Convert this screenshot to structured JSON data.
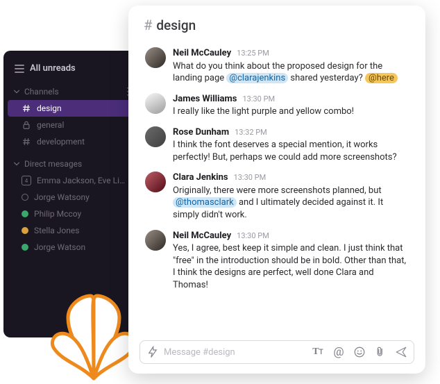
{
  "sidebar": {
    "all_unreads": "All unreads",
    "channels_label": "Channels",
    "channels": [
      {
        "label": "design",
        "iconName": "hash-icon",
        "active": true
      },
      {
        "label": "general",
        "iconName": "lock-icon",
        "active": false
      },
      {
        "label": "development",
        "iconName": "hash-icon",
        "active": false
      }
    ],
    "dms_label": "Direct mesages",
    "dms": [
      {
        "label": "Emma Jackson, Eve Li…",
        "indicator": "group",
        "indicatorText": "4"
      },
      {
        "label": "Jorge Watsony",
        "indicator": "offline"
      },
      {
        "label": "Philip Mccoy",
        "indicator": "online"
      },
      {
        "label": "Stella Jones",
        "indicator": "away"
      },
      {
        "label": "Jorge Watson",
        "indicator": "online"
      }
    ]
  },
  "channel": {
    "symbol": "#",
    "name": "design",
    "composer_placeholder": "Message #design"
  },
  "messages": [
    {
      "author": "Neil McCauley",
      "time": "13:25 PM",
      "avatar": "a1",
      "segments": [
        {
          "t": "What do you think about the proposed design for the landing page "
        },
        {
          "t": "@clarajenkins",
          "cls": "mention-user"
        },
        {
          "t": " shared yesterday? "
        },
        {
          "t": "@here",
          "cls": "mention-here"
        }
      ]
    },
    {
      "author": "James Williams",
      "time": "13:30 PM",
      "avatar": "a2",
      "segments": [
        {
          "t": "I really like the light purple and yellow combo!"
        }
      ]
    },
    {
      "author": "Rose Dunham",
      "time": "13:32 PM",
      "avatar": "a3",
      "segments": [
        {
          "t": "I think the font deserves a special mention, it works perfectly! But, perhaps we could add more screenshots?"
        }
      ]
    },
    {
      "author": "Clara Jenkins",
      "time": "13:30 PM",
      "avatar": "a4",
      "segments": [
        {
          "t": "Originally, there were more screenshots planned, but "
        },
        {
          "t": "@thomasclark",
          "cls": "mention-user"
        },
        {
          "t": " and I ultimately decided against it. It simply didn't work."
        }
      ]
    },
    {
      "author": "Neil McCauley",
      "time": "13:30 PM",
      "avatar": "a1",
      "segments": [
        {
          "t": "Yes, I agree, best keep it simple and clean. I just think that \"free\" in the introduction should be in bold. Other than that, I think the designs are perfect, well done Clara and Thomas!"
        }
      ]
    }
  ],
  "colors": {
    "sidebar_bg": "#1a1621",
    "active_item": "#4b2d7a",
    "mention_user_bg": "#cfe6f7",
    "mention_here_bg": "#f6c65b",
    "leaf_stroke": "#ee8a1d"
  }
}
